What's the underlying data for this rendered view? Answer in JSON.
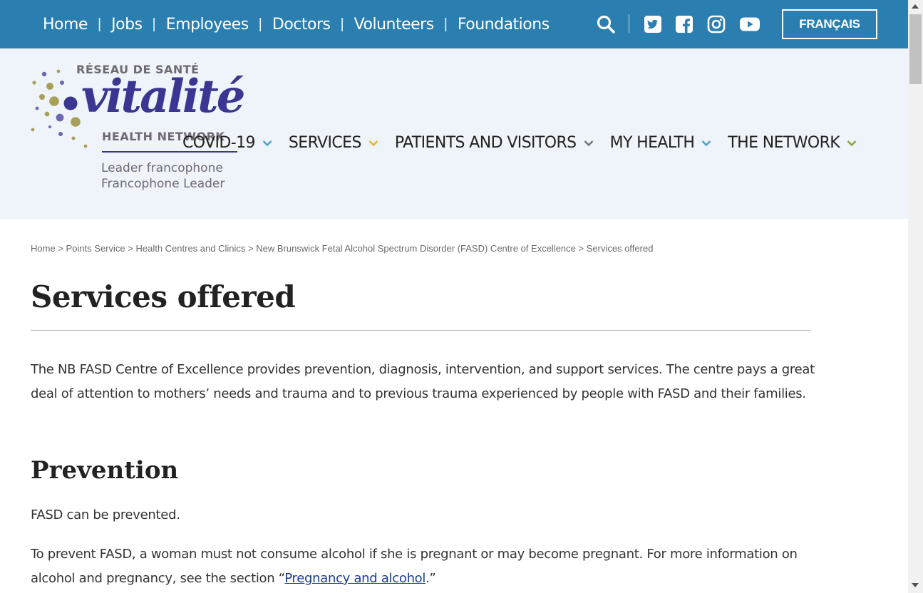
{
  "topnav": {
    "items": [
      "Home",
      "Jobs",
      "Employees",
      "Doctors",
      "Volunteers",
      "Foundations"
    ],
    "language_button": "FRANÇAIS"
  },
  "logo": {
    "top_text": "RÉSEAU DE SANTÉ",
    "word": "vitalité",
    "sub_text": "HEALTH NETWORK",
    "tagline_fr": "Leader francophone",
    "tagline_en": "Francophone Leader"
  },
  "mainnav": {
    "items": [
      {
        "label": "COVID-19",
        "chevron_color": "#4da3d6"
      },
      {
        "label": "SERVICES",
        "chevron_color": "#e2b53a"
      },
      {
        "label": "PATIENTS AND VISITORS",
        "chevron_color": "#777777"
      },
      {
        "label": "MY HEALTH",
        "chevron_color": "#4da3d6"
      },
      {
        "label": "THE NETWORK",
        "chevron_color": "#8aa63c"
      }
    ]
  },
  "breadcrumb": [
    "Home",
    "Points Service",
    "Health Centres and Clinics",
    "New Brunswick Fetal Alcohol Spectrum Disorder (FASD) Centre of Excellence",
    "Services offered"
  ],
  "breadcrumb_sep": ">",
  "page": {
    "title": "Services offered",
    "intro": "The NB FASD Centre of Excellence provides prevention, diagnosis, intervention, and support services. The centre pays a great deal of attention to mothers’ needs and trauma and to previous trauma experienced by people with FASD and their families.",
    "section1_title": "Prevention",
    "section1_p1": "FASD can be prevented.",
    "section1_p2_before": "To prevent FASD, a woman must not consume alcohol if she is pregnant or may become pregnant. For more information on alcohol and pregnancy, see the section “",
    "section1_p2_link": "Pregnancy and alcohol",
    "section1_p2_after": ".”"
  },
  "colors": {
    "topbar": "#2b7fb0",
    "header_bg": "#eef4f9",
    "logo_purple": "#3a3691",
    "link": "#1a3d8f"
  },
  "icons": [
    "search-icon",
    "twitter-icon",
    "facebook-icon",
    "instagram-icon",
    "youtube-icon"
  ]
}
